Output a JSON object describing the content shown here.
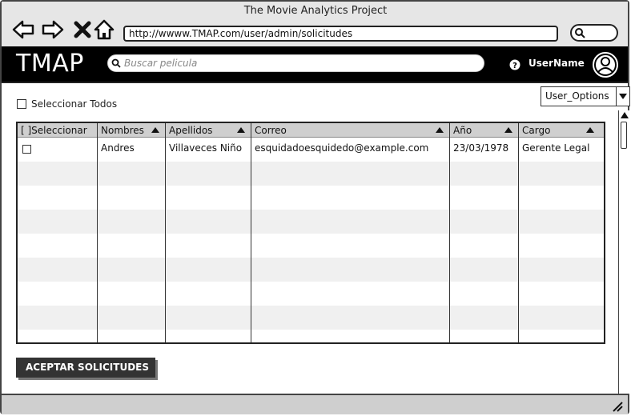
{
  "browser": {
    "title": "The Movie Analytics Project",
    "url": "http://wwww.TMAP.com/user/admin/solicitudes",
    "icons": [
      "back-icon",
      "forward-icon",
      "close-icon",
      "home-icon",
      "search-icon"
    ]
  },
  "header": {
    "logo": "TMAP",
    "search_placeholder": "Buscar pelicula",
    "help_icon": "help-icon",
    "username": "UserName",
    "avatar_icon": "user-avatar-icon",
    "background": "#000000"
  },
  "toolbar": {
    "select_all_label": "Seleccionar Todos",
    "user_options_label": "User_Options"
  },
  "table": {
    "headers": [
      "[ ]Seleccionar",
      "Nombres",
      "Apellidos",
      "Correo",
      "Año",
      "Cargo"
    ],
    "rows": [
      {
        "checked": false,
        "nombres": "Andres",
        "apellidos": "Villaveces Niño",
        "correo": "esquidadoesquidedo@example.com",
        "anio": "23/03/1978",
        "cargo": "Gerente Legal"
      }
    ]
  },
  "actions": {
    "accept_label": "ACEPTAR SOLICITUDES"
  }
}
